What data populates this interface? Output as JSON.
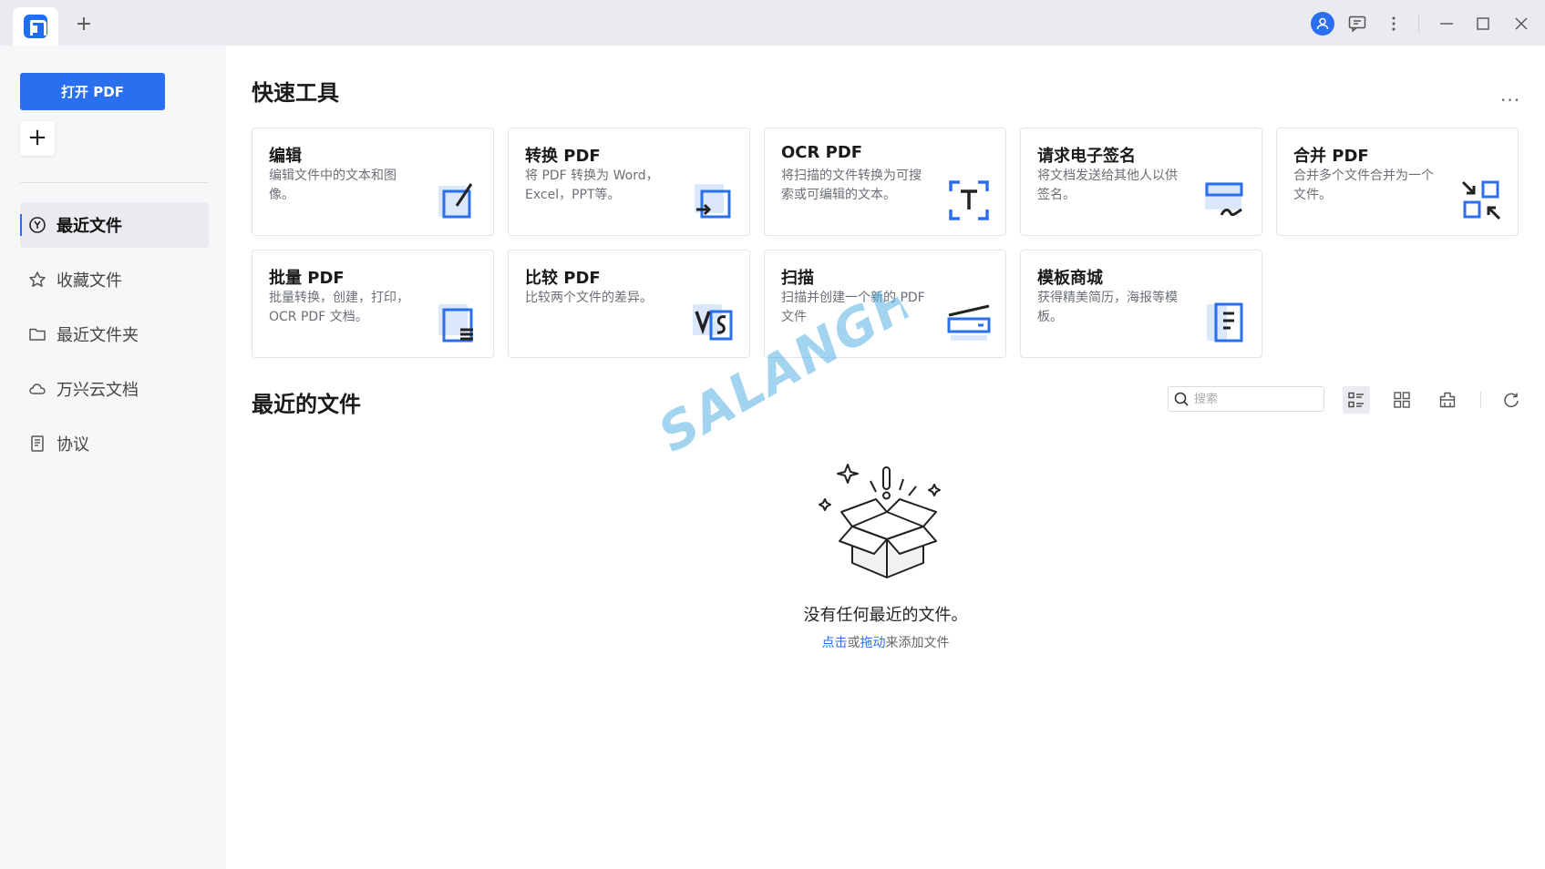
{
  "sidebar": {
    "open_button": "打开 PDF",
    "add_button": "+",
    "items": [
      {
        "label": "最近文件",
        "icon": "clock-icon",
        "active": true
      },
      {
        "label": "收藏文件",
        "icon": "star-icon",
        "active": false
      },
      {
        "label": "最近文件夹",
        "icon": "folder-icon",
        "active": false
      },
      {
        "label": "万兴云文档",
        "icon": "cloud-icon",
        "active": false
      },
      {
        "label": "协议",
        "icon": "document-icon",
        "active": false
      }
    ]
  },
  "main": {
    "quick_tools_title": "快速工具",
    "more_label": "...",
    "tools": [
      {
        "title": "编辑",
        "desc": "编辑文件中的文本和图像。",
        "icon": "edit-icon"
      },
      {
        "title": "转换 PDF",
        "desc": "将 PDF 转换为 Word，Excel，PPT等。",
        "icon": "convert-icon"
      },
      {
        "title": "OCR PDF",
        "desc": "将扫描的文件转换为可搜索或可编辑的文本。",
        "icon": "ocr-icon"
      },
      {
        "title": "请求电子签名",
        "desc": "将文档发送给其他人以供签名。",
        "icon": "signature-icon"
      },
      {
        "title": "合并 PDF",
        "desc": "合并多个文件合并为一个文件。",
        "icon": "merge-icon"
      },
      {
        "title": "批量 PDF",
        "desc": "批量转换，创建，打印，OCR PDF 文档。",
        "icon": "batch-icon"
      },
      {
        "title": "比较 PDF",
        "desc": "比较两个文件的差异。",
        "icon": "compare-icon"
      },
      {
        "title": "扫描",
        "desc": "扫描并创建一个新的 PDF 文件",
        "icon": "scan-icon"
      },
      {
        "title": "模板商城",
        "desc": "获得精美简历，海报等模板。",
        "icon": "template-icon"
      }
    ],
    "recent_title": "最近的文件",
    "search_placeholder": "搜索",
    "empty_title": "没有任何最近的文件。",
    "empty_hint": {
      "click": "点击",
      "or": "或",
      "drag": "拖动",
      "suffix": "来添加文件"
    }
  },
  "watermark": "SALANGHE",
  "colors": {
    "accent": "#2a6ff0",
    "sidebar_bg": "#f6f7f9",
    "titlebar_bg": "#e9ebee"
  }
}
